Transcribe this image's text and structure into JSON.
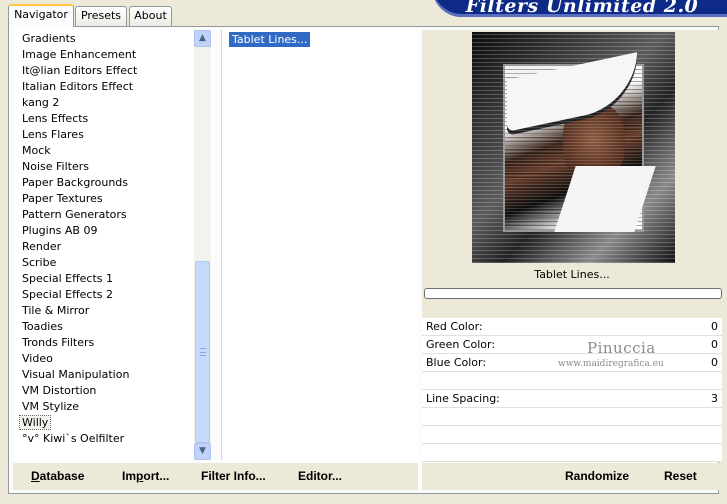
{
  "tabs": [
    {
      "label": "Navigator",
      "active": true
    },
    {
      "label": "Presets",
      "active": false
    },
    {
      "label": "About",
      "active": false
    }
  ],
  "brand_title": "Filters Unlimited 2.0",
  "categories": [
    "Gradients",
    "Image Enhancement",
    "It@lian Editors Effect",
    "Italian Editors Effect",
    "kang 2",
    "Lens Effects",
    "Lens Flares",
    "Mock",
    "Noise Filters",
    "Paper Backgrounds",
    "Paper Textures",
    "Pattern Generators",
    "Plugins AB 09",
    "Render",
    "Scribe",
    "Special Effects 1",
    "Special Effects 2",
    "Tile & Mirror",
    "Toadies",
    "Tronds Filters",
    "Video",
    "Visual Manipulation",
    "VM Distortion",
    "VM Stylize",
    "Willy",
    "°v° Kiwi`s Oelfilter"
  ],
  "selected_category": "Willy",
  "filters": [
    "Tablet Lines..."
  ],
  "selected_filter": "Tablet Lines...",
  "preview": {
    "filter_title": "Tablet Lines..."
  },
  "parameters": [
    {
      "label": "Red Color:",
      "value": "0"
    },
    {
      "label": "Green Color:",
      "value": "0"
    },
    {
      "label": "Blue Color:",
      "value": "0"
    },
    {
      "label": "",
      "value": ""
    },
    {
      "label": "Line Spacing:",
      "value": "3"
    }
  ],
  "watermark": {
    "name": "Pinuccia",
    "url": "www.maidiregrafica.eu"
  },
  "buttons": {
    "database": {
      "label": "atabase",
      "underline": "D"
    },
    "import": {
      "label": "mport...",
      "underline": "I",
      "prefix": "Im"
    },
    "filter_info": {
      "label": "Filter Info..."
    },
    "editor": {
      "label": "Editor..."
    },
    "randomize": {
      "label": "Randomize"
    },
    "reset": {
      "label": "Reset"
    }
  }
}
